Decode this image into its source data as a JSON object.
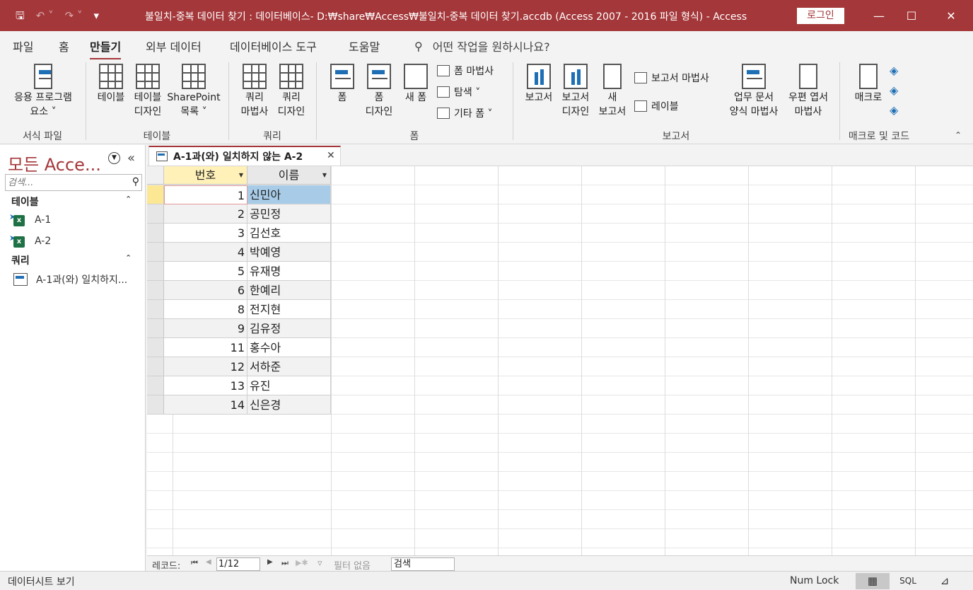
{
  "window": {
    "title": "불일치-중복 데이터 찾기 : 데이터베이스- D:₩share₩Access₩불일치-중복 데이터 찾기.accdb (Access 2007 - 2016 파일 형식)  -  Access",
    "login": "로그인",
    "qat_icons": [
      "save-icon",
      "undo-icon",
      "redo-icon",
      "customize-icon"
    ]
  },
  "ribbon_tabs": [
    {
      "label": "파일",
      "active": false
    },
    {
      "label": "홈",
      "active": false
    },
    {
      "label": "만들기",
      "active": true
    },
    {
      "label": "외부 데이터",
      "active": false
    },
    {
      "label": "데이터베이스 도구",
      "active": false
    },
    {
      "label": "도움말",
      "active": false
    }
  ],
  "tell_me": "어떤 작업을 원하시나요?",
  "groups": {
    "templates": {
      "label": "서식 파일",
      "app_parts": [
        "응용 프로그램",
        "요소 ˅"
      ]
    },
    "tables": {
      "label": "테이블",
      "table": "테이블",
      "table_design": [
        "테이블",
        "디자인"
      ],
      "sharepoint": [
        "SharePoint",
        "목록 ˅"
      ]
    },
    "queries": {
      "label": "쿼리",
      "wizard": [
        "쿼리",
        "마법사"
      ],
      "design": [
        "쿼리",
        "디자인"
      ]
    },
    "forms": {
      "label": "폼",
      "form": "폼",
      "form_design": [
        "폼",
        "디자인"
      ],
      "blank": "새 폼",
      "wizard": "폼 마법사",
      "navigation": "탐색 ˅",
      "more": "기타 폼 ˅"
    },
    "reports": {
      "label": "보고서",
      "report": "보고서",
      "report_design": [
        "보고서",
        "디자인"
      ],
      "blank": [
        "새",
        "보고서"
      ],
      "wizard": "보고서 마법사",
      "labels": "레이블",
      "biz_wizard": [
        "업무 문서",
        "양식 마법사"
      ],
      "postcard": [
        "우편 엽서",
        "마법사"
      ]
    },
    "macros": {
      "label": "매크로 및 코드",
      "macro": "매크로"
    }
  },
  "nav": {
    "title": "모든 Acce...",
    "search_placeholder": "검색...",
    "groups": [
      {
        "label": "테이블",
        "items": [
          "A-1",
          "A-2"
        ]
      },
      {
        "label": "쿼리",
        "items": [
          "A-1과(와) 일치하지..."
        ]
      }
    ]
  },
  "document": {
    "tab_label": "A-1과(와) 일치하지 않는 A-2",
    "columns": [
      "번호",
      "이름"
    ],
    "rows": [
      {
        "num": "1",
        "name": "신민아"
      },
      {
        "num": "2",
        "name": "공민정"
      },
      {
        "num": "3",
        "name": "김선호"
      },
      {
        "num": "4",
        "name": "박예영"
      },
      {
        "num": "5",
        "name": "유재명"
      },
      {
        "num": "6",
        "name": "한예리"
      },
      {
        "num": "8",
        "name": "전지현"
      },
      {
        "num": "9",
        "name": "김유정"
      },
      {
        "num": "11",
        "name": "홍수아"
      },
      {
        "num": "12",
        "name": "서하준"
      },
      {
        "num": "13",
        "name": "유진"
      },
      {
        "num": "14",
        "name": "신은경"
      }
    ]
  },
  "record_nav": {
    "label": "레코드:",
    "position": "1/12",
    "filter": "필터 없음",
    "search": "검색"
  },
  "status": {
    "view_label": "데이터시트 보기",
    "num_lock": "Num Lock",
    "sql": "SQL"
  },
  "colors": {
    "accent": "#a4373a",
    "selection": "#a8cce8",
    "current_row": "#fce795"
  }
}
